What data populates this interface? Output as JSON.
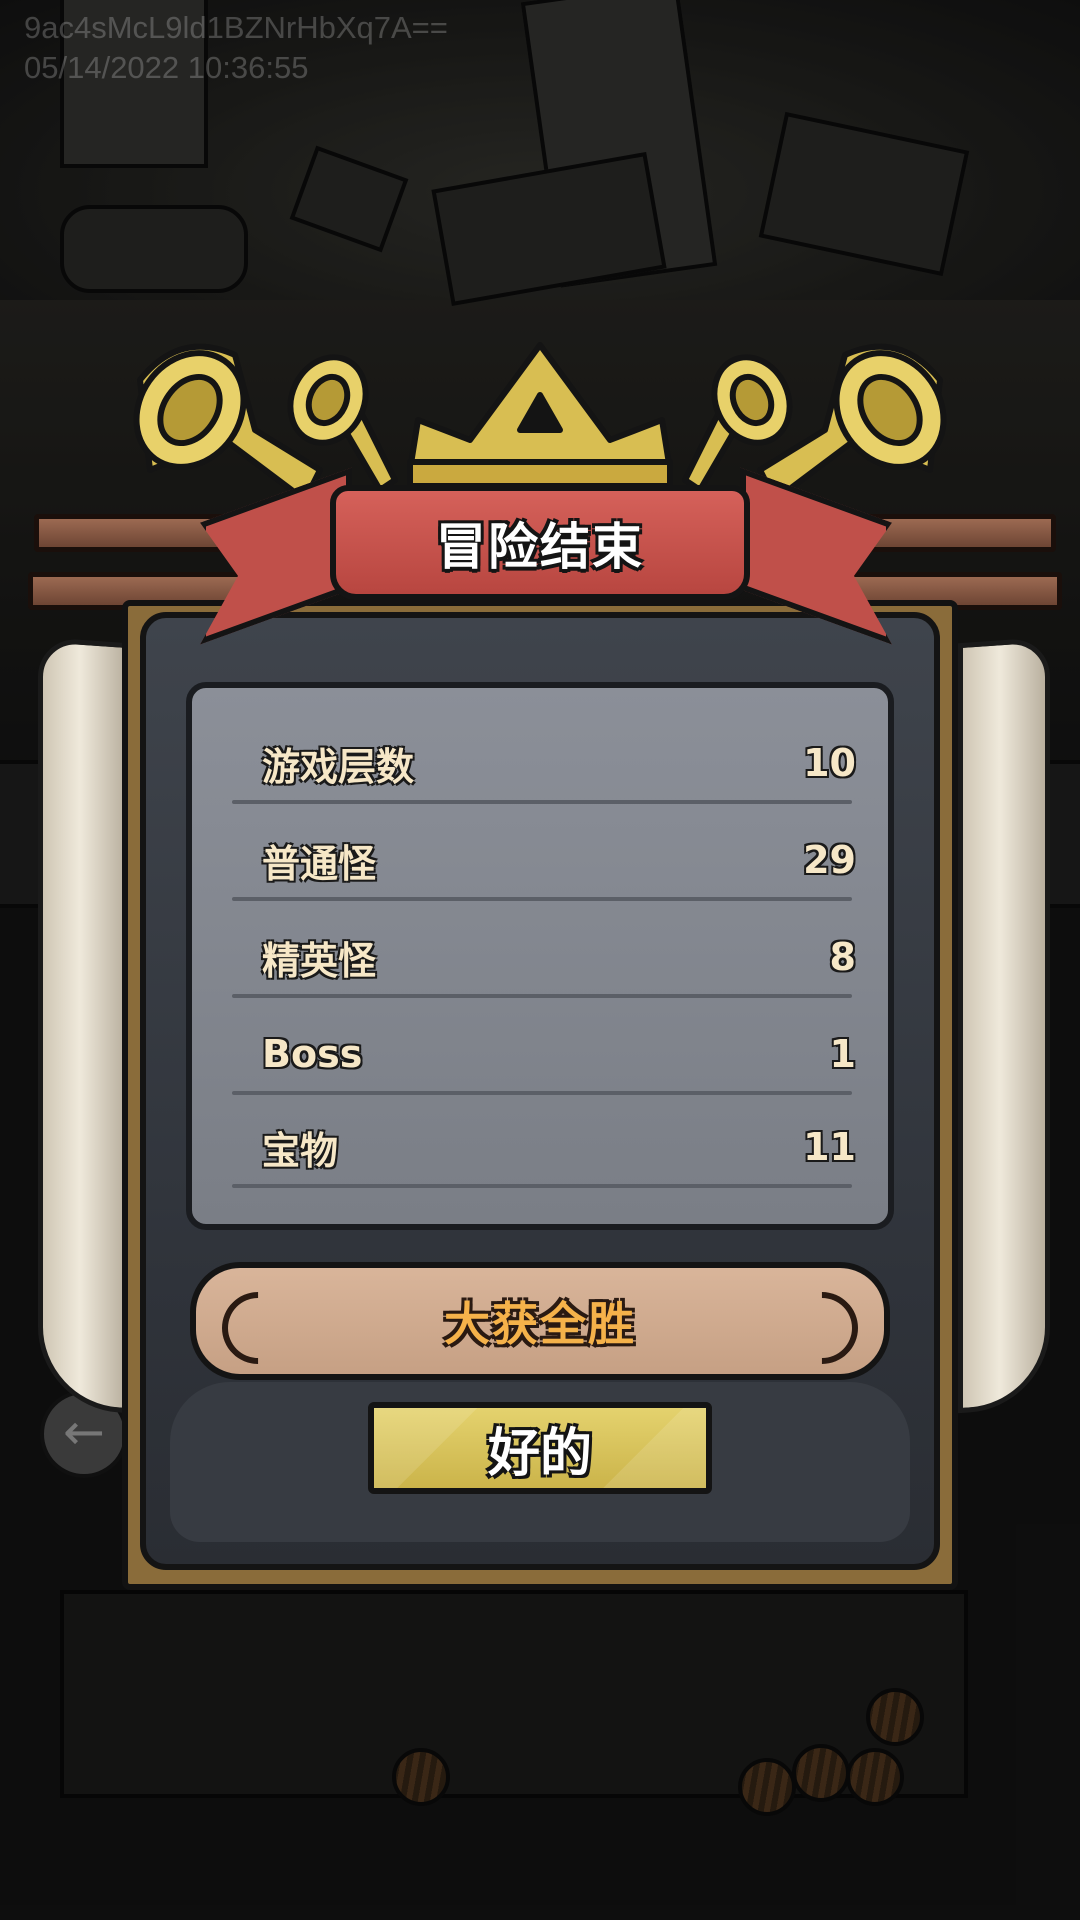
{
  "watermark": {
    "line1": "9ac4sMcL9ld1BZNrHbXq7A==",
    "line2": "05/14/2022 10:36:55"
  },
  "dialog": {
    "title": "冒险结束",
    "stats": [
      {
        "label": "游戏层数",
        "value": "10"
      },
      {
        "label": "普通怪",
        "value": "29"
      },
      {
        "label": "精英怪",
        "value": "8"
      },
      {
        "label": "Boss",
        "value": "1"
      },
      {
        "label": "宝物",
        "value": "11"
      }
    ],
    "result": "大获全胜",
    "ok_label": "好的"
  },
  "colors": {
    "ribbon": "#c0504a",
    "gold": "#d8be52",
    "panel": "#858991",
    "result_banner": "#d2ad91",
    "result_text": "#f5b24a",
    "stat_text": "#f6e7c7"
  },
  "icons": [
    "horn-icon",
    "crown-icon",
    "back-arrow-icon",
    "coin-icon"
  ]
}
